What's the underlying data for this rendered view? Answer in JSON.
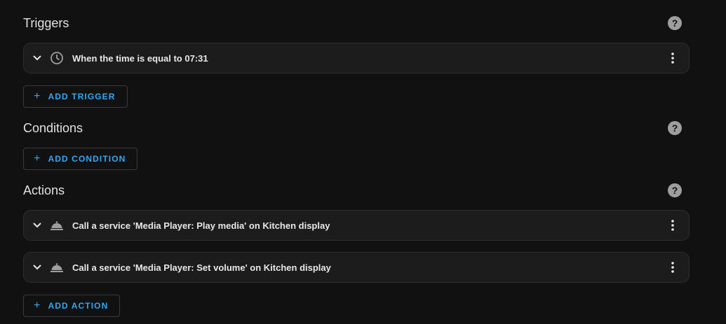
{
  "triggers": {
    "title": "Triggers",
    "items": [
      {
        "label": "When the time is equal to 07:31",
        "icon": "clock-icon"
      }
    ],
    "add_label": "ADD TRIGGER"
  },
  "conditions": {
    "title": "Conditions",
    "add_label": "ADD CONDITION"
  },
  "actions": {
    "title": "Actions",
    "items": [
      {
        "label": "Call a service 'Media Player: Play media' on Kitchen display",
        "icon": "room-service-icon"
      },
      {
        "label": "Call a service 'Media Player: Set volume' on Kitchen display",
        "icon": "room-service-icon"
      }
    ],
    "add_label": "ADD ACTION"
  },
  "help_symbol": "?",
  "add_symbol": "+",
  "colors": {
    "background": "#111111",
    "card": "#1c1c1c",
    "accent": "#30a8f3",
    "text": "#e1e1e1",
    "icon": "#9e9e9e"
  }
}
